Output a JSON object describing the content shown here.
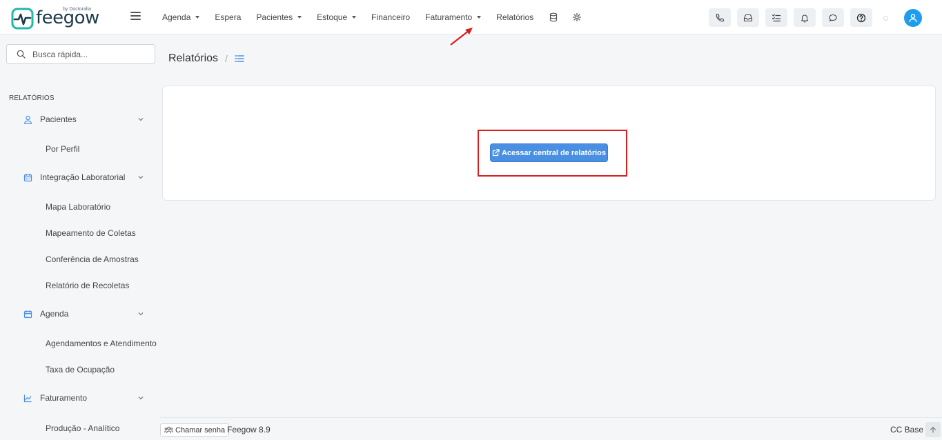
{
  "logo": {
    "text": "feegow",
    "by": "by Doctoralia"
  },
  "nav": {
    "items": [
      {
        "label": "Agenda",
        "dropdown": true
      },
      {
        "label": "Espera",
        "dropdown": false
      },
      {
        "label": "Pacientes",
        "dropdown": true
      },
      {
        "label": "Estoque",
        "dropdown": true
      },
      {
        "label": "Financeiro",
        "dropdown": false
      },
      {
        "label": "Faturamento",
        "dropdown": true
      },
      {
        "label": "Relatórios",
        "dropdown": false
      }
    ],
    "icons": [
      "database-icon",
      "gear-icon"
    ]
  },
  "top_icons": [
    "phone-icon",
    "inbox-icon",
    "tasks-icon",
    "bell-icon",
    "chat-icon",
    "help-icon"
  ],
  "colors": {
    "accent": "#1f9bf0",
    "primary_button": "#4a90e2",
    "annotation": "#d91c1c",
    "icon_blue": "#4a90e2"
  },
  "search": {
    "placeholder": "Busca rápida..."
  },
  "sidebar": {
    "heading": "RELATÓRIOS",
    "groups": [
      {
        "label": "Pacientes",
        "icon": "user-icon",
        "items": [
          "Por Perfil"
        ]
      },
      {
        "label": "Integração Laboratorial",
        "icon": "calendar-icon",
        "items": [
          "Mapa Laboratório",
          "Mapeamento de Coletas",
          "Conferência de Amostras",
          "Relatório de Recoletas"
        ]
      },
      {
        "label": "Agenda",
        "icon": "calendar-icon",
        "items": [
          "Agendamentos e Atendimento",
          "Taxa de Ocupação"
        ]
      },
      {
        "label": "Faturamento",
        "icon": "chart-icon",
        "items": [
          "Produção - Analítico"
        ]
      }
    ]
  },
  "page": {
    "title": "Relatórios",
    "separator": "/"
  },
  "main": {
    "button_label": "Acessar central de relatórios"
  },
  "footer": {
    "chamar_label": "Chamar senha",
    "version": "Feegow 8.9",
    "unit": "CC Base"
  }
}
